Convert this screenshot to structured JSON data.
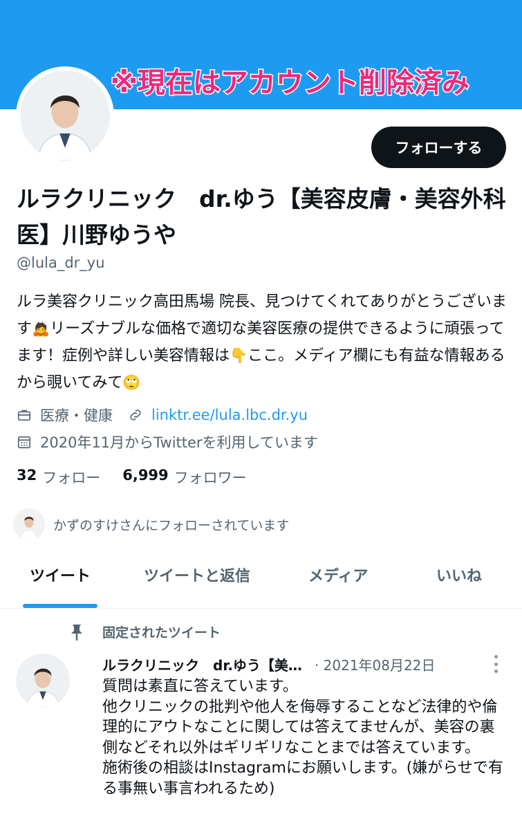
{
  "banner": {
    "caption": "※現在はアカウント削除済み"
  },
  "profile": {
    "name": "ルラクリニック　dr.ゆう【美容皮膚・美容外科医】川野ゆうや",
    "handle": "@lula_dr_yu",
    "follow_label": "フォローする",
    "bio": {
      "part1": "ルラ美容クリニック高田馬場 院長、見つけてくれてありがとうございます",
      "emoji1": "🙇",
      "part2": "リーズナブルな価格で適切な美容医療の提供できるように頑張ってます！症例や詳しい美容情報は",
      "emoji2": "👇",
      "part3": "ここ。メディア欄にも有益な情報あるから覗いてみて",
      "emoji3": "🙄"
    },
    "category": "医療・健康",
    "link": "linktr.ee/lula.lbc.dr.yu",
    "joined": "2020年11月からTwitterを利用しています",
    "following_count": "32",
    "following_label": "フォロー",
    "followers_count": "6,999",
    "followers_label": "フォロワー",
    "followed_by": "かずのすけさんにフォローされています"
  },
  "tabs": [
    {
      "label": "ツイート"
    },
    {
      "label": "ツイートと返信"
    },
    {
      "label": "メディア"
    },
    {
      "label": "いいね"
    }
  ],
  "pinned_tweet": {
    "pinned_label": "固定されたツイート",
    "author": "ルラクリニック　dr.ゆう【美…",
    "date": "· 2021年08月22日",
    "lines": [
      "質問は素直に答えています。",
      "他クリニックの批判や他人を侮辱することなど法律的や倫理的にアウトなことに関しては答えてませんが、美容の裏側などそれ以外はギリギリなことまでは答えています。",
      "施術後の相談はInstagramにお願いします。(嫌がらせで有る事無い事言われるため)"
    ]
  }
}
